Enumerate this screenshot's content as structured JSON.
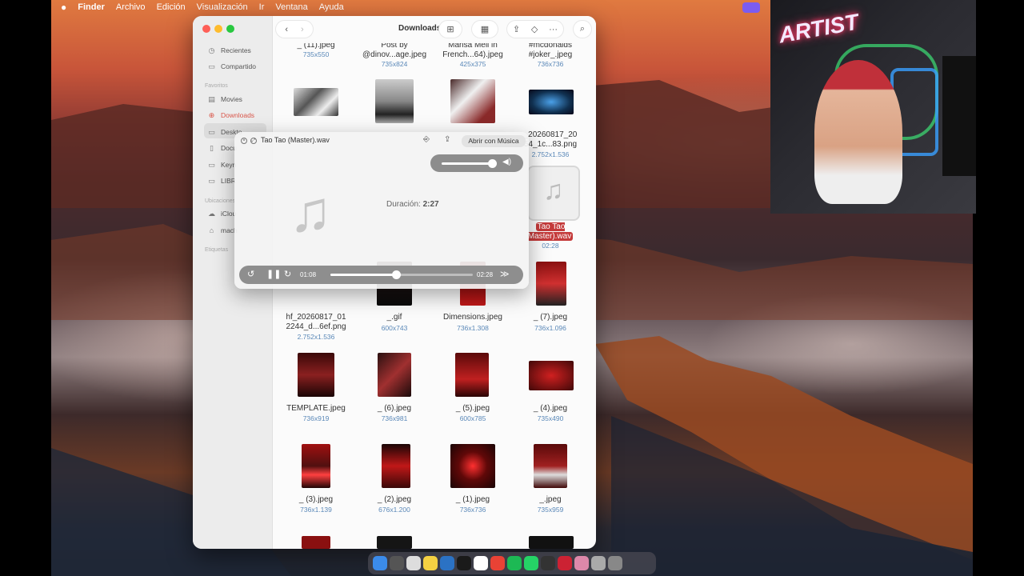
{
  "menubar": {
    "apple": "",
    "app": "Finder",
    "items": [
      "Archivo",
      "Edición",
      "Visualización",
      "Ir",
      "Ventana",
      "Ayuda"
    ]
  },
  "sidebar": {
    "items": [
      {
        "label": "Recientes",
        "icon": "clock-icon"
      },
      {
        "label": "Compartido",
        "icon": "folder-shared-icon"
      }
    ],
    "section_favorites": "Favoritos",
    "favorites": [
      {
        "label": "Movies",
        "icon": "film-icon"
      },
      {
        "label": "Downloads",
        "icon": "download-icon"
      },
      {
        "label": "Deskto",
        "icon": "desktop-icon"
      },
      {
        "label": "Docu",
        "icon": "document-icon"
      },
      {
        "label": "Keyn",
        "icon": "folder-icon"
      },
      {
        "label": "LIBR",
        "icon": "folder-icon"
      }
    ],
    "section_locations": "Ubicaciones",
    "locations": [
      {
        "label": "iClou",
        "icon": "cloud-icon"
      },
      {
        "label": "mach",
        "icon": "house-icon"
      }
    ],
    "section_tags": "Etiquetas"
  },
  "toolbar": {
    "title": "Downloads"
  },
  "files": [
    {
      "name": "_ (11).jpeg",
      "dims": "735x550"
    },
    {
      "name": "Post by @dinov...age.jpeg",
      "dims": "735x824"
    },
    {
      "name": "Marisa Mell in French...64).jpeg",
      "dims": "425x375"
    },
    {
      "name": "#mcdonalds #joker_.jpeg",
      "dims": "736x736"
    },
    {
      "name": "_20260817_20 54_1c...83.png",
      "dims": "2.752x1.536"
    },
    {
      "name": "Tao Tao Master).wav",
      "dims": "02:28"
    },
    {
      "name": "hf_20260817_01 2244_d...6ef.png",
      "dims": "2.752x1.536"
    },
    {
      "name": "_.gif",
      "dims": "600x743"
    },
    {
      "name": "Dimensions.jpeg",
      "dims": "736x1.308"
    },
    {
      "name": "_ (7).jpeg",
      "dims": "736x1.096"
    },
    {
      "name": "TEMPLATE.jpeg",
      "dims": "736x919"
    },
    {
      "name": "_ (6).jpeg",
      "dims": "736x981"
    },
    {
      "name": "_ (5).jpeg",
      "dims": "600x785"
    },
    {
      "name": "_ (4).jpeg",
      "dims": "735x490"
    },
    {
      "name": "_ (3).jpeg",
      "dims": "736x1.139"
    },
    {
      "name": "_ (2).jpeg",
      "dims": "676x1.200"
    },
    {
      "name": "_ (1).jpeg",
      "dims": "736x736"
    },
    {
      "name": "_.jpeg",
      "dims": "735x959"
    }
  ],
  "player": {
    "title": "Tao Tao (Master).wav",
    "open_with": "Abrir con Música",
    "duration_label": "Duración:",
    "duration_value": "2:27",
    "elapsed": "01:08",
    "total": "02:28",
    "progress": 0.46,
    "volume": 0.95
  },
  "webcam": {
    "neon_text": "ARTIST"
  },
  "colors": {
    "accent": "#d9564a",
    "selection": "#c43a3a",
    "dims": "#5a88b8"
  }
}
